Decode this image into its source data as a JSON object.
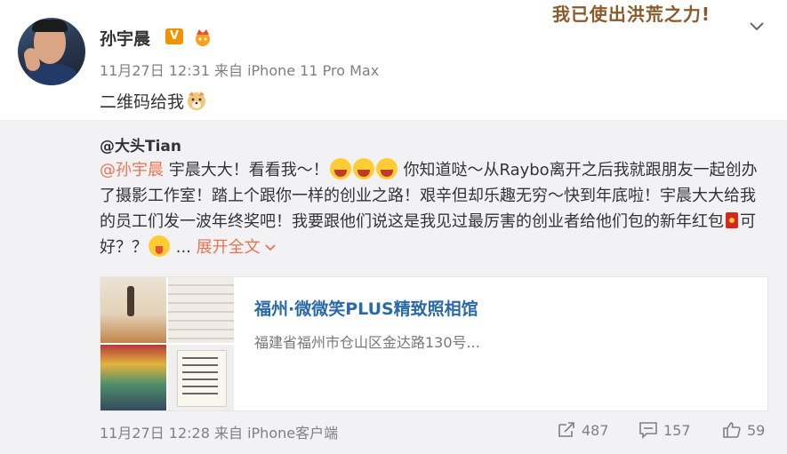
{
  "post": {
    "author": "孙宇晨",
    "verified_badge": "V",
    "banner_text": "我已使出洪荒之力!",
    "meta": "11月27日 12:31 来自 iPhone 11 Pro Max",
    "content": "二维码给我"
  },
  "retweet": {
    "author": "@大头Tian",
    "mention": "@孙宇晨",
    "text_1": " 宇晨大大！看看我～！",
    "text_2": " 你知道哒～从Raybo离开之后我就跟朋友一起创办了摄影工作室！踏上个跟你一样的创业之路！艰辛但却乐趣无穷～快到年底啦！宇晨大大给我的员工们发一波年终奖吧！我要跟他们说这是我见过最厉害的创业者给他们包的新年红包",
    "text_3": "可好？？",
    "ellipsis": " ... ",
    "expand_label": "展开全文",
    "card": {
      "title": "福州·微微笑PLUS精致照相馆",
      "address": "福建省福州市仓山区金达路130号..."
    },
    "footer_meta": "11月27日 12:28 来自 iPhone客户端",
    "repost_count": "487",
    "comment_count": "157",
    "like_count": "59"
  },
  "icons": [
    "chevron-down-icon",
    "crown-icon",
    "doge-emoji-icon",
    "laugh-emoji-icon",
    "red-packet-icon",
    "tongue-emoji-icon",
    "repost-icon",
    "comment-icon",
    "like-icon"
  ],
  "colors": {
    "link": "#eb7350",
    "card_title": "#2a6aa8",
    "retweet_bg": "#f2f2f5"
  }
}
